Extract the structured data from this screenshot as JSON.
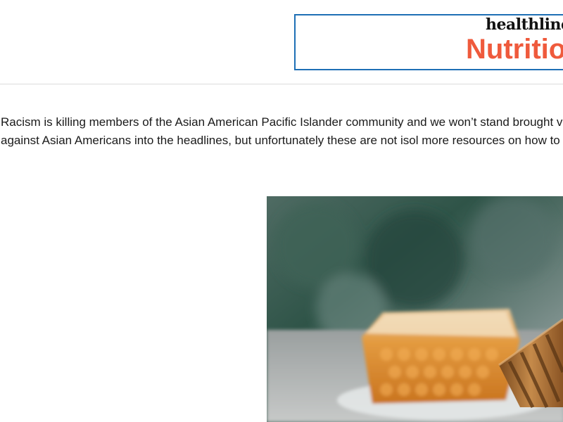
{
  "header": {
    "logo": {
      "brand": "healthline",
      "section": "Nutrition"
    }
  },
  "banner": {
    "text": "Racism is killing members of the Asian American Pacific Islander community and we won’t stand brought violence against Asian Americans into the headlines, but unfortunately these are not isol more resources on how to get involved."
  },
  "hero_image": {
    "icon": "honeycomb-honey-dipper-photo"
  },
  "colors": {
    "logo_border": "#1e6fb5",
    "logo_accent": "#ef5a3c",
    "divider": "#dcdcdc"
  }
}
